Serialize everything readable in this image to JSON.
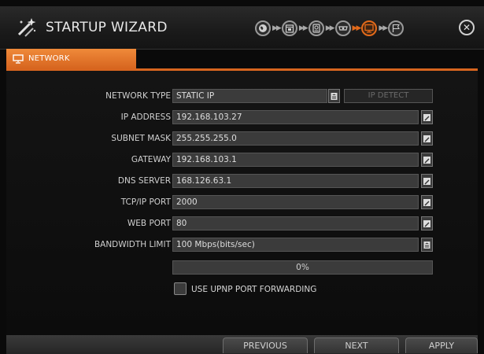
{
  "header": {
    "title": "STARTUP WIZARD",
    "steps": [
      {
        "icon": "globe-icon",
        "active": false
      },
      {
        "icon": "calendar-icon",
        "active": false
      },
      {
        "icon": "hdd-icon",
        "active": false
      },
      {
        "icon": "camera-icon",
        "active": false
      },
      {
        "icon": "network-monitor-icon",
        "active": true
      },
      {
        "icon": "finish-flag-icon",
        "active": false
      }
    ],
    "close_icon": "close-icon"
  },
  "tab": {
    "label": "NETWORK",
    "icon": "monitor-icon"
  },
  "form": {
    "network_type": {
      "label": "NETWORK TYPE",
      "value": "STATIC IP",
      "detect_button": "IP DETECT"
    },
    "ip_address": {
      "label": "IP ADDRESS",
      "value": "192.168.103.27"
    },
    "subnet_mask": {
      "label": "SUBNET MASK",
      "value": "255.255.255.0"
    },
    "gateway": {
      "label": "GATEWAY",
      "value": "192.168.103.1"
    },
    "dns_server": {
      "label": "DNS SERVER",
      "value": "168.126.63.1"
    },
    "tcpip_port": {
      "label": "TCP/IP PORT",
      "value": "2000"
    },
    "web_port": {
      "label": "WEB PORT",
      "value": "80"
    },
    "bandwidth_limit": {
      "label": "BANDWIDTH LIMIT",
      "value": "100 Mbps(bits/sec)"
    },
    "progress": {
      "text": "0%",
      "fraction": 0
    },
    "upnp": {
      "label": "USE UPNP PORT FORWARDING",
      "checked": false
    }
  },
  "footer": {
    "previous": "PREVIOUS",
    "next": "NEXT",
    "apply": "APPLY"
  },
  "colors": {
    "accent": "#d7651f",
    "field_bg": "#3b3b3b",
    "background": "#0b0b0b"
  }
}
